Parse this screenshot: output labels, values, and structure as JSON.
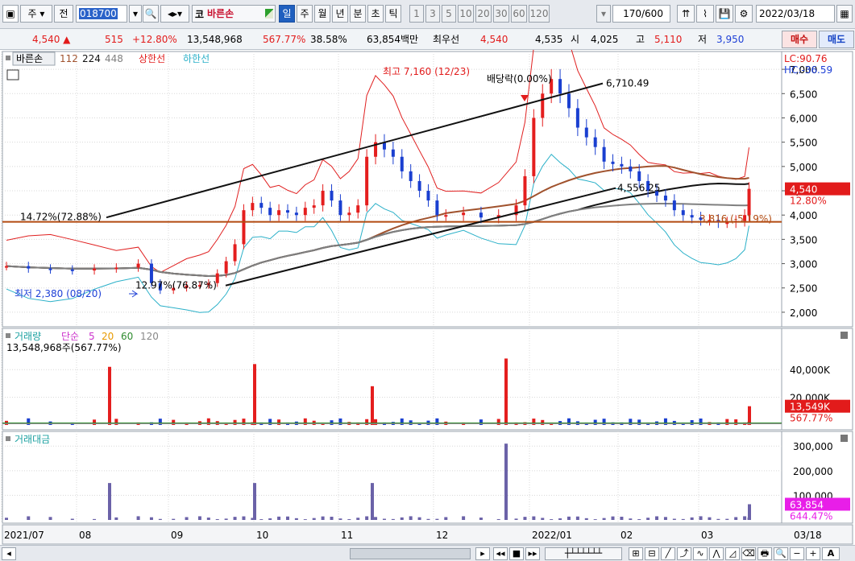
{
  "toolbar": {
    "market_label": "주",
    "prev_label": "전",
    "code": "018700",
    "code_prefix": "코",
    "stock_name": "바른손",
    "periods": [
      "일",
      "주",
      "월",
      "년",
      "분",
      "초",
      "틱"
    ],
    "active_period": "일",
    "intervals": [
      "1",
      "3",
      "5",
      "10",
      "20",
      "30",
      "60",
      "120"
    ],
    "count": "170",
    "total": "/600",
    "date": "2022/03/18"
  },
  "info": {
    "price": "4,540",
    "change": "515",
    "change_pct": "+12.80%",
    "volume": "13,548,968",
    "volume_pct": "567.77%",
    "turnover": "38.58%",
    "amount": "63,854백만",
    "best_ask_label": "최우선",
    "ask": "4,540",
    "bid": "4,535",
    "open_label": "시",
    "open": "4,025",
    "high_label": "고",
    "high": "5,110",
    "low_label": "저",
    "low": "3,950",
    "buy_label": "매수",
    "sell_label": "매도"
  },
  "price_panel": {
    "name_badge": "바른손",
    "ma": [
      {
        "label": "112",
        "color": "#a0522d"
      },
      {
        "label": "224",
        "color": "#111111"
      },
      {
        "label": "448",
        "color": "#808080"
      }
    ],
    "upper_label": "상한선",
    "lower_label": "하한선",
    "lc": "LC:90.76",
    "hc": "HC:-36.59",
    "high_note": "최고 7,160 (12/23)",
    "low_note": "최저 2,380 (08/20)",
    "ex_note": "배당락(0.00%)",
    "trend_high_label": "6,710.49",
    "trend_mid_label": "4,556.25",
    "trend_low_label": "3,816 (-5.19%)",
    "hline_label": "14.72%(72.88%)",
    "low_pct_label": "12.97%(76.87%)",
    "yticks": [
      "7,000",
      "6,500",
      "6,000",
      "5,500",
      "5,000",
      "4,500",
      "4,000",
      "3,500",
      "3,000",
      "2,500",
      "2,000"
    ],
    "last_price": "4,540",
    "last_pct": "12.80%"
  },
  "volume_panel": {
    "label": "거래량",
    "ma_label": "단순",
    "ma": [
      {
        "label": "5",
        "color": "#cc33cc"
      },
      {
        "label": "20",
        "color": "#e89a00"
      },
      {
        "label": "60",
        "color": "#2e8b2e"
      },
      {
        "label": "120",
        "color": "#888888"
      }
    ],
    "value": "13,548,968주(567.77%)",
    "yticks": [
      "40,000K",
      "20,000K"
    ],
    "last_value": "13,549K",
    "last_pct": "567.77%"
  },
  "amount_panel": {
    "label": "거래대금",
    "yticks": [
      "300,000",
      "200,000",
      "100,000"
    ],
    "last_value": "63,854",
    "last_pct": "644.47%"
  },
  "xaxis": [
    "2021/07",
    "08",
    "09",
    "10",
    "11",
    "12",
    "2022/01",
    "02",
    "03",
    "03/18"
  ],
  "chart_data": {
    "type": "candlestick",
    "title": "바른손",
    "ylim": [
      1800,
      7300
    ],
    "series_close": [
      [
        0,
        2950
      ],
      [
        5,
        2900
      ],
      [
        10,
        2880
      ],
      [
        15,
        2860
      ],
      [
        20,
        2900
      ],
      [
        25,
        2920
      ],
      [
        30,
        3000
      ],
      [
        33,
        2600
      ],
      [
        35,
        2450
      ],
      [
        38,
        2500
      ],
      [
        41,
        2550
      ],
      [
        44,
        2560
      ],
      [
        46,
        2600
      ],
      [
        48,
        2800
      ],
      [
        50,
        3050
      ],
      [
        52,
        3400
      ],
      [
        54,
        4100
      ],
      [
        56,
        4250
      ],
      [
        58,
        4150
      ],
      [
        60,
        4000
      ],
      [
        62,
        4100
      ],
      [
        64,
        4050
      ],
      [
        66,
        4000
      ],
      [
        68,
        4150
      ],
      [
        70,
        4200
      ],
      [
        72,
        4500
      ],
      [
        74,
        4300
      ],
      [
        76,
        4000
      ],
      [
        78,
        4050
      ],
      [
        80,
        4200
      ],
      [
        82,
        5200
      ],
      [
        84,
        5500
      ],
      [
        86,
        5350
      ],
      [
        88,
        5200
      ],
      [
        90,
        4900
      ],
      [
        92,
        4700
      ],
      [
        94,
        4500
      ],
      [
        96,
        4300
      ],
      [
        98,
        4000
      ],
      [
        100,
        4000
      ],
      [
        104,
        4050
      ],
      [
        108,
        3950
      ],
      [
        112,
        4000
      ],
      [
        116,
        4200
      ],
      [
        118,
        4800
      ],
      [
        120,
        6000
      ],
      [
        122,
        6500
      ],
      [
        124,
        6800
      ],
      [
        126,
        6500
      ],
      [
        128,
        6200
      ],
      [
        130,
        5800
      ],
      [
        132,
        5600
      ],
      [
        134,
        5400
      ],
      [
        136,
        5100
      ],
      [
        138,
        5050
      ],
      [
        140,
        5000
      ],
      [
        142,
        4900
      ],
      [
        144,
        4700
      ],
      [
        146,
        4500
      ],
      [
        148,
        4400
      ],
      [
        150,
        4300
      ],
      [
        152,
        4100
      ],
      [
        154,
        4000
      ],
      [
        156,
        3950
      ],
      [
        158,
        3900
      ],
      [
        160,
        3900
      ],
      [
        162,
        3850
      ],
      [
        164,
        3850
      ],
      [
        166,
        3880
      ],
      [
        168,
        4000
      ],
      [
        169,
        4540
      ]
    ],
    "volume_spikes": [
      {
        "x": "08",
        "value": 42000
      },
      {
        "x": "10",
        "value": 44000
      },
      {
        "x": "11",
        "value": 28000
      },
      {
        "x": "12",
        "value": 48000
      },
      {
        "x": "03/18",
        "value": 13549
      }
    ]
  }
}
